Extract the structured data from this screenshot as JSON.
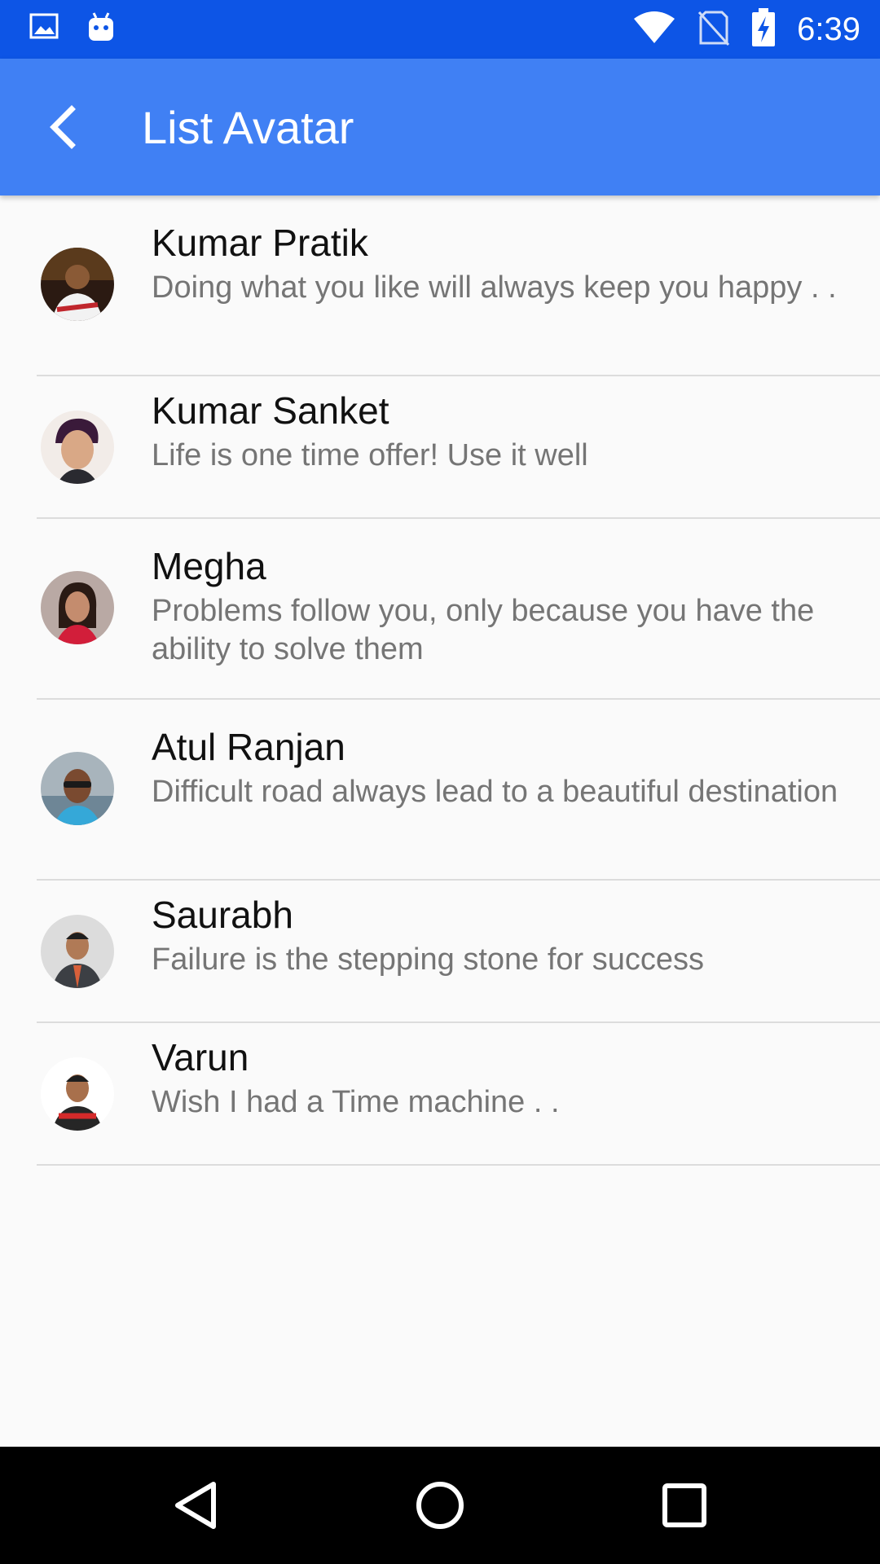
{
  "status_bar": {
    "time": "6:39",
    "icons": [
      "image-icon",
      "android-icon",
      "wifi-icon",
      "no-sim-icon",
      "battery-charging-icon"
    ]
  },
  "app_bar": {
    "title": "List Avatar",
    "back_icon": "back-arrow-icon"
  },
  "contacts": [
    {
      "name": "Kumar Pratik",
      "quote": "Doing what you like will always keep you happy . ."
    },
    {
      "name": "Kumar Sanket",
      "quote": "Life is one time offer! Use it well"
    },
    {
      "name": "Megha",
      "quote": "Problems follow you, only because you have the ability to solve them"
    },
    {
      "name": "Atul Ranjan",
      "quote": "Difficult road always lead to a beautiful destination"
    },
    {
      "name": "Saurabh",
      "quote": "Failure is the stepping stone for success"
    },
    {
      "name": "Varun",
      "quote": "Wish I had a Time machine . ."
    }
  ],
  "nav_bar": {
    "icons": [
      "back-triangle-icon",
      "home-circle-icon",
      "recents-square-icon"
    ]
  },
  "colors": {
    "status_bar": "#0d55e6",
    "app_bar": "#4080f4",
    "background": "#fafafa",
    "name_text": "#111111",
    "quote_text": "#757575"
  }
}
